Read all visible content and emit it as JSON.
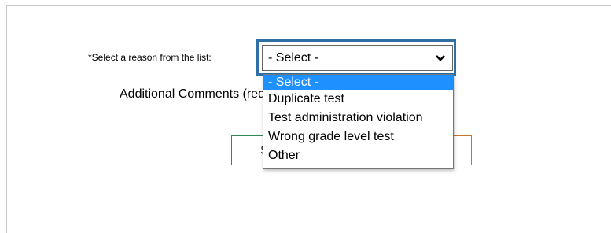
{
  "form": {
    "reason_label": "*Select a reason from the list:",
    "select_value": "- Select -",
    "comments_text": "Additional Comments (required when 'Other' is selected)",
    "options": [
      "- Select -",
      "Duplicate test",
      "Test administration violation",
      "Wrong grade level test",
      "Other"
    ],
    "highlight_color": "#1e90ff",
    "focus_border_color": "#2f6fa3",
    "submit_border_color": "#2e8b57",
    "cancel_border_color": "#c8742e"
  }
}
